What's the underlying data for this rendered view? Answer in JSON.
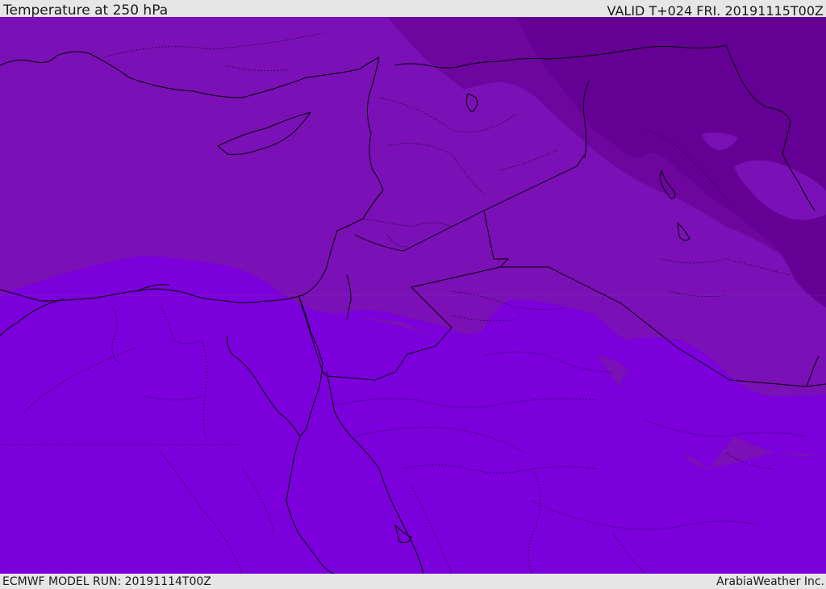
{
  "header": {
    "title": "Temperature at 250 hPa",
    "valid": "VALID T+024 FRI. 20191115T00Z"
  },
  "footer": {
    "model_run": "ECMWF MODEL RUN: 20191114T00Z",
    "credit": "ArabiaWeather Inc."
  },
  "map": {
    "colors": {
      "band_warm": "#7b00db",
      "band_mid": "#7a10b5",
      "band_cool": "#6e059f",
      "band_cold": "#650094",
      "coastline": "#000000",
      "border": "#000000"
    }
  }
}
